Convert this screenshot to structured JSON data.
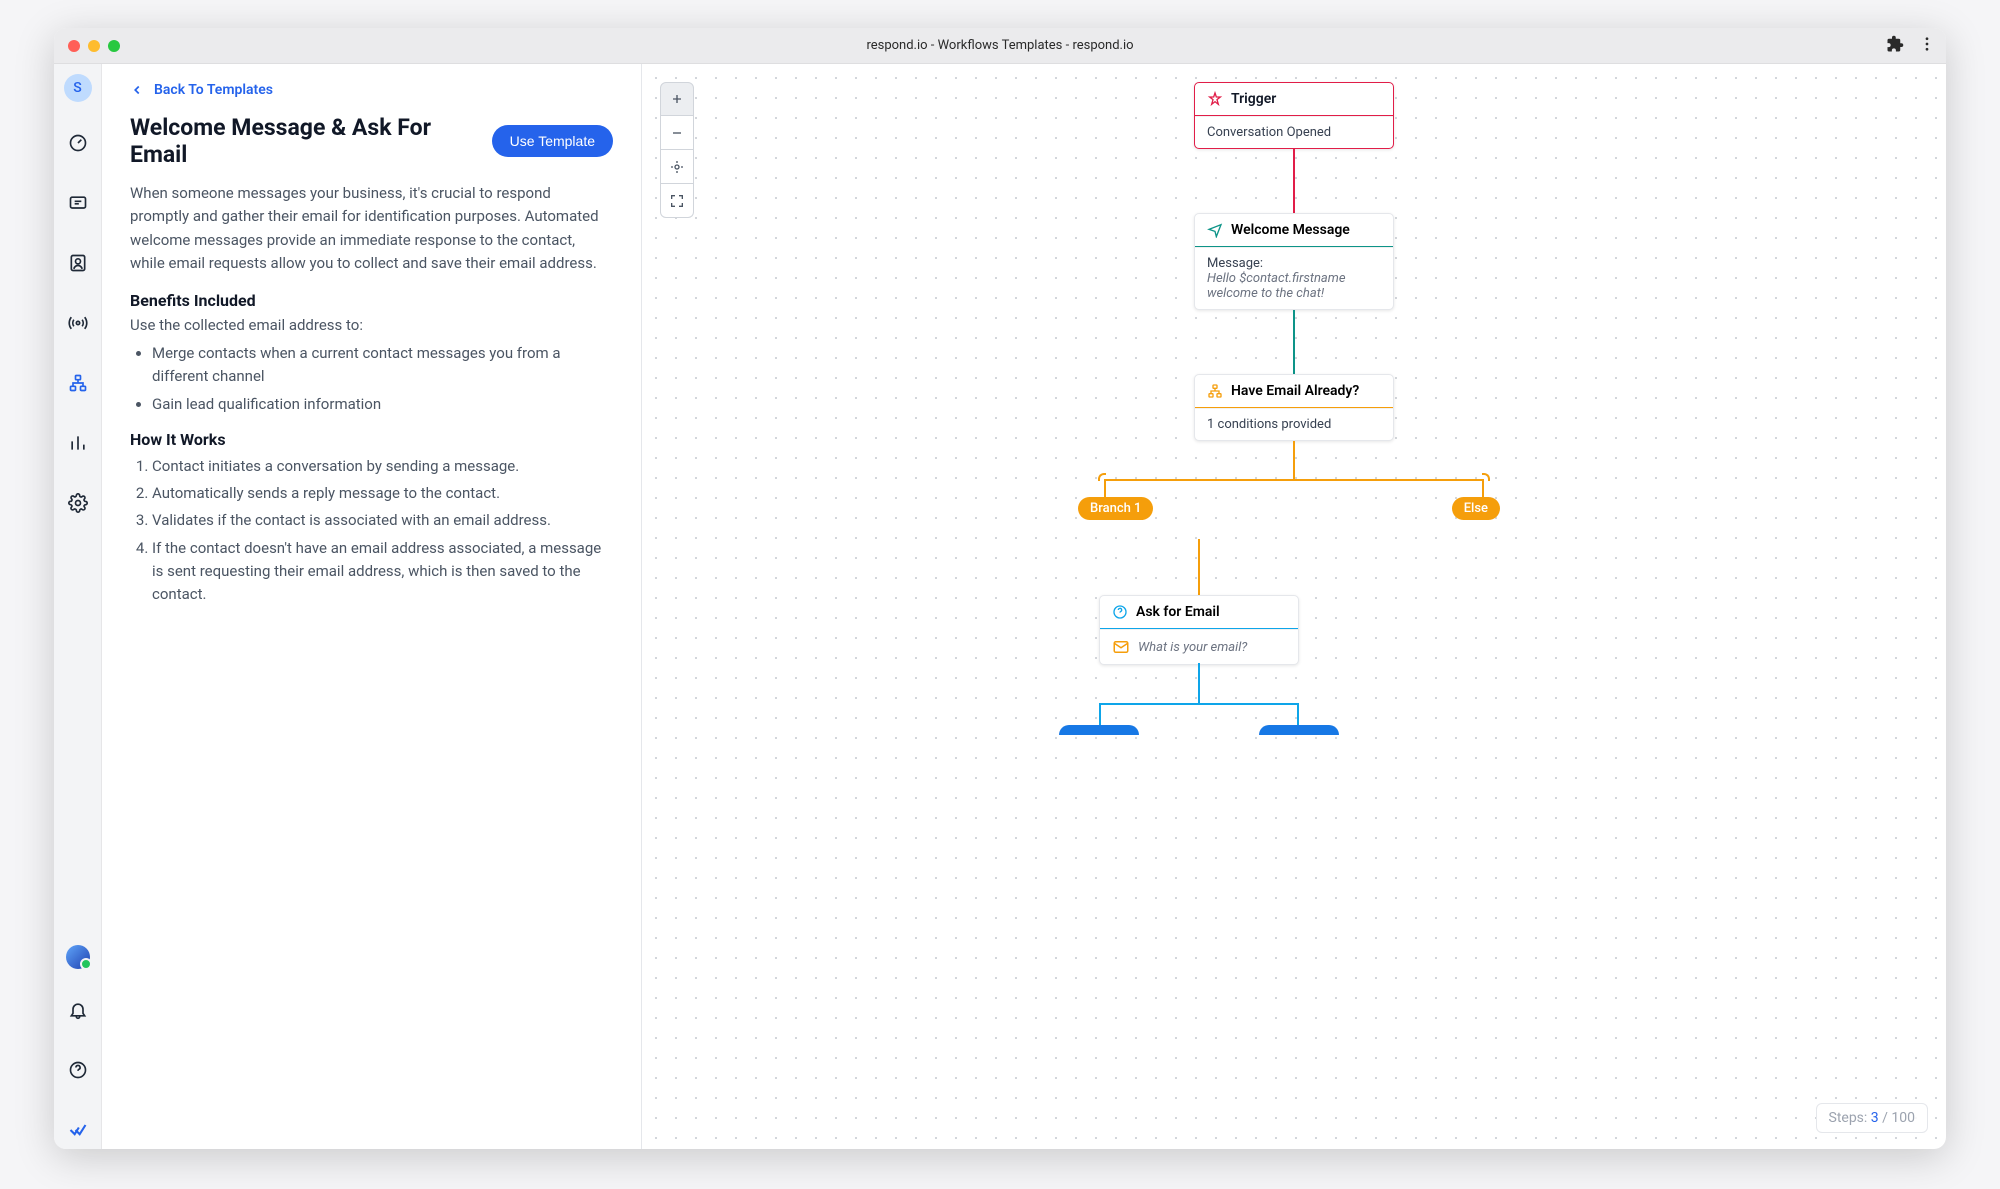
{
  "window": {
    "title": "respond.io - Workflows Templates - respond.io"
  },
  "sidenav": {
    "avatar_letter": "S"
  },
  "panel": {
    "back_label": "Back To Templates",
    "heading": "Welcome Message & Ask For Email",
    "use_button": "Use Template",
    "description": "When someone messages your business, it's crucial to respond promptly and gather their email for identification purposes. Automated welcome messages provide an immediate response to the contact, while email requests allow you to collect and save their email address.",
    "benefits_heading": "Benefits Included",
    "benefits_sub": "Use the collected email address to:",
    "benefits": [
      "Merge contacts when a current contact messages you from a different channel",
      "Gain lead qualification information"
    ],
    "how_heading": "How It Works",
    "how_steps": [
      "Contact initiates a conversation by sending a message.",
      "Automatically sends a reply message to the contact.",
      "Validates if the contact is associated with an email address.",
      "If the contact doesn't have an email address associated, a message is sent requesting their email address, which is then saved to the contact."
    ]
  },
  "flow": {
    "trigger": {
      "title": "Trigger",
      "detail": "Conversation Opened"
    },
    "welcome": {
      "title": "Welcome Message",
      "msg_label": "Message:",
      "msg_text": "Hello $contact.firstname welcome to the chat!"
    },
    "condition": {
      "title": "Have Email Already?",
      "detail": "1 conditions provided"
    },
    "branches": {
      "branch1": "Branch 1",
      "else": "Else"
    },
    "ask": {
      "title": "Ask for Email",
      "prompt": "What is your email?"
    }
  },
  "steps": {
    "label": "Steps:",
    "current": "3",
    "sep": " / ",
    "total": "100"
  }
}
